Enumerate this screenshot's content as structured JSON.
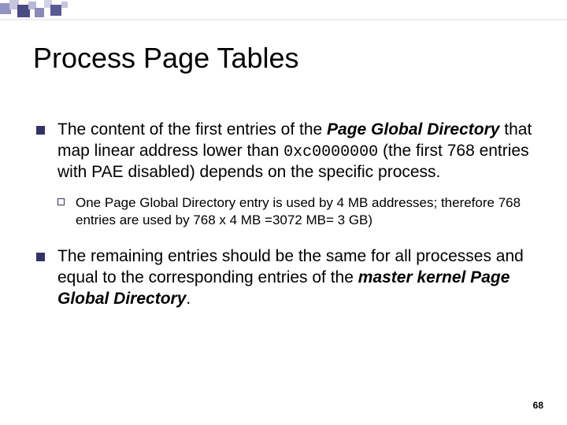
{
  "title": "Process Page Tables",
  "p1": {
    "a": "The content of the first entries of the ",
    "b": "Page Global Directory",
    "c": " that map linear address lower than ",
    "d": "0xc0000000",
    "e": " (the first 768 entries with PAE disabled) depends on the specific process."
  },
  "sub": "One Page Global Directory entry is used by 4 MB addresses; therefore 768 entries are used by 768 x 4 MB =3072 MB= 3 GB)",
  "p2": {
    "a": "The remaining entries should be the same for all processes and equal to the corresponding entries of the ",
    "b": "master kernel Page Global Directory",
    "c": "."
  },
  "page_number": "68"
}
